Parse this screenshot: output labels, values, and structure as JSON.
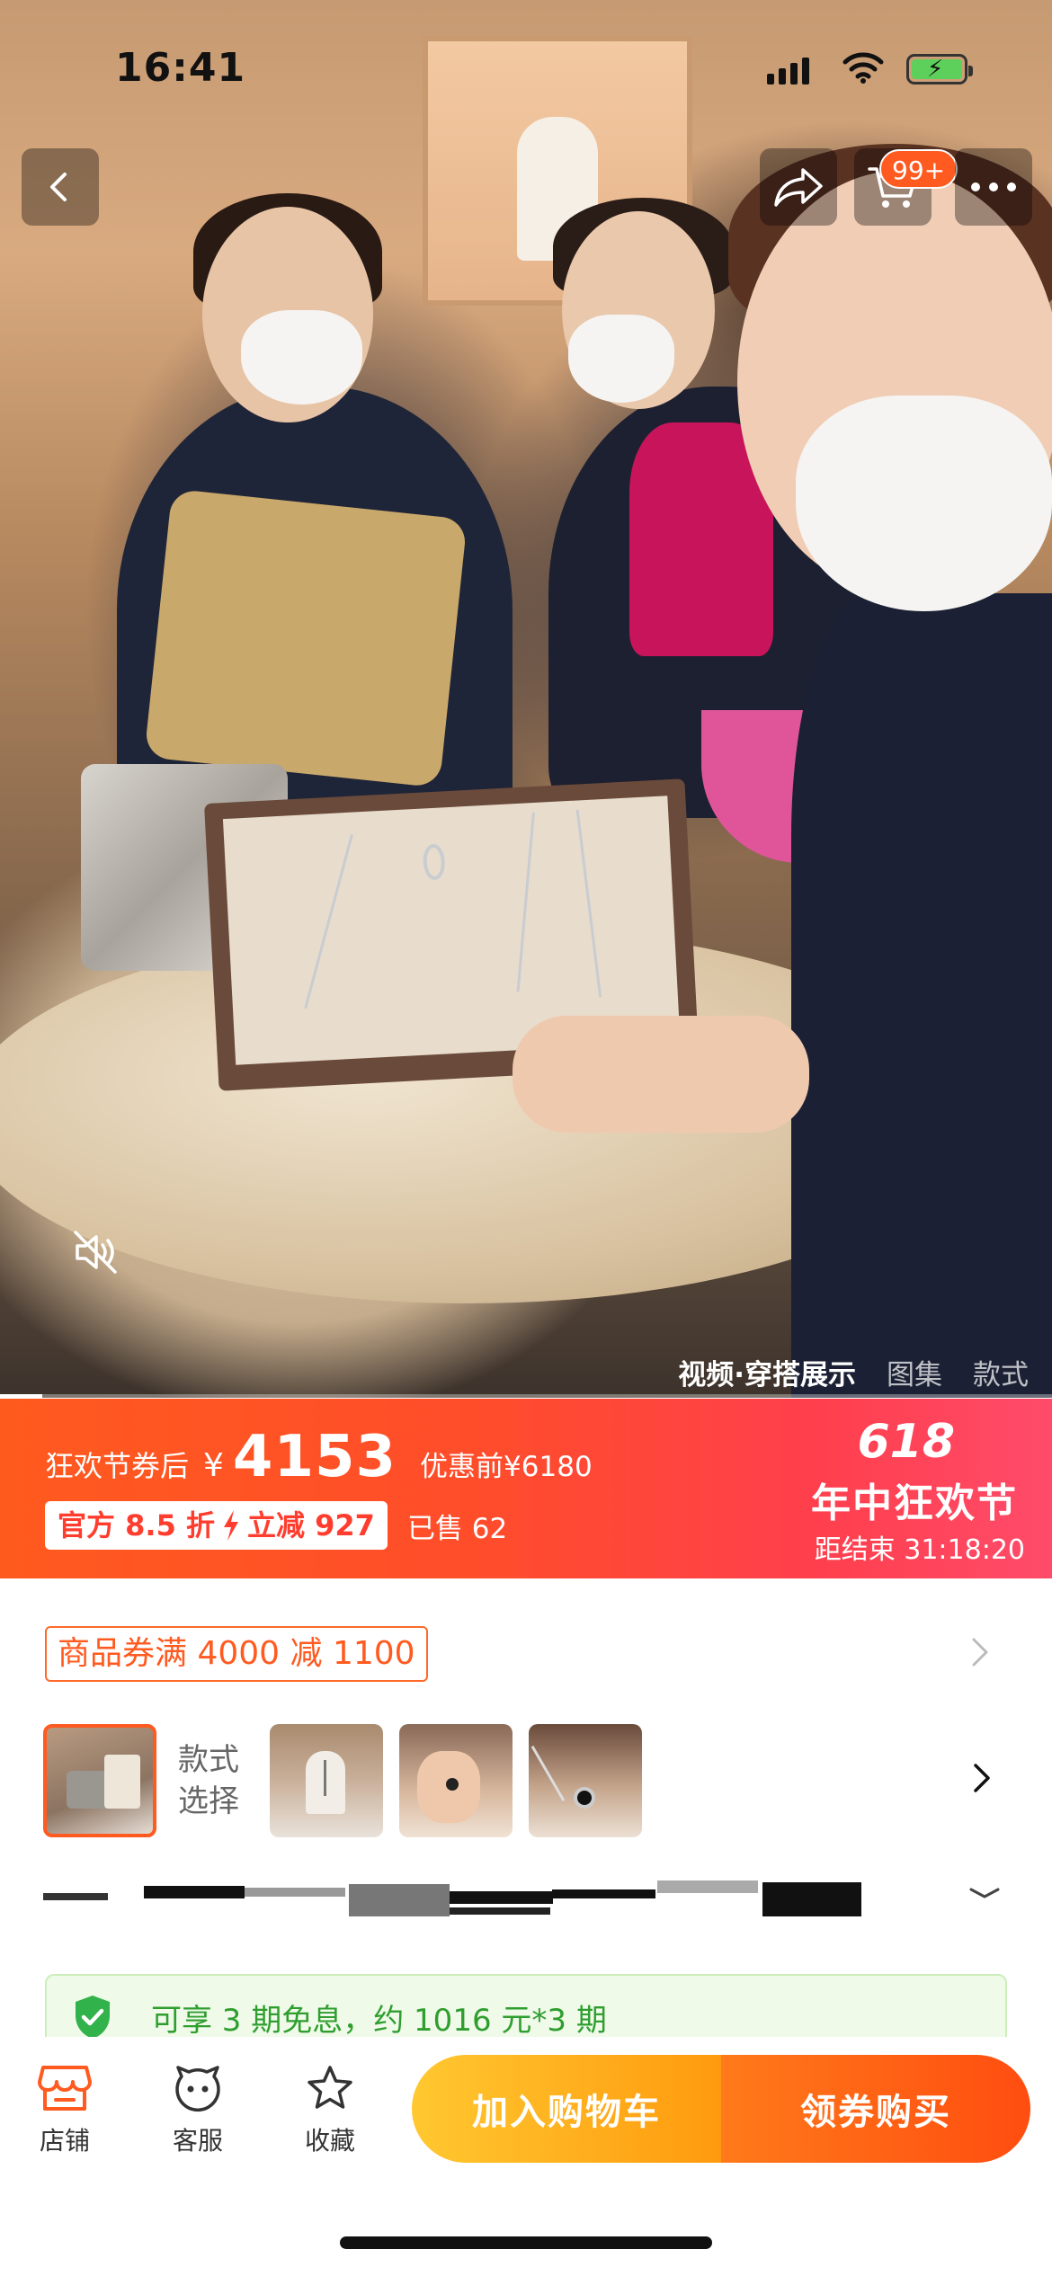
{
  "status_bar": {
    "time": "16:41"
  },
  "top_controls": {
    "cart_badge": "99+"
  },
  "media": {
    "tabs": [
      {
        "label": "视频·穿搭展示",
        "active": true
      },
      {
        "label": "图集",
        "active": false
      },
      {
        "label": "款式",
        "active": false
      }
    ],
    "video_progress": 0.04
  },
  "price_banner": {
    "prefix": "狂欢节券后",
    "currency": "¥",
    "price": "4153",
    "original_price": "优惠前¥6180",
    "discount_part1": "官方 8.5 折",
    "discount_part2": "立减 927",
    "sold": "已售 62",
    "event_number": "618",
    "event_name": "年中狂欢节",
    "countdown": "距结束 31:18:20"
  },
  "coupon": {
    "label": "商品券满 4000 减 1100"
  },
  "variants": {
    "label": "款式 选择"
  },
  "installment": {
    "text": "可享 3 期免息，约 1016 元*3 期"
  },
  "bottom_bar": {
    "shop": "店铺",
    "service": "客服",
    "favorite": "收藏",
    "add_to_cart": "加入购物车",
    "buy": "领券购买"
  },
  "colors": {
    "accent_orange": "#ff5a1f",
    "banner_red": "#ff3f4d",
    "cart_yellow": "#ffc830",
    "installment_green": "#2f9e2f"
  },
  "icons": [
    "back-icon",
    "share-icon",
    "cart-icon",
    "more-icon",
    "mute-icon",
    "chevron-right-icon",
    "chevron-down-icon",
    "shield-check-icon",
    "shop-icon",
    "service-icon",
    "star-icon",
    "bolt-icon"
  ]
}
